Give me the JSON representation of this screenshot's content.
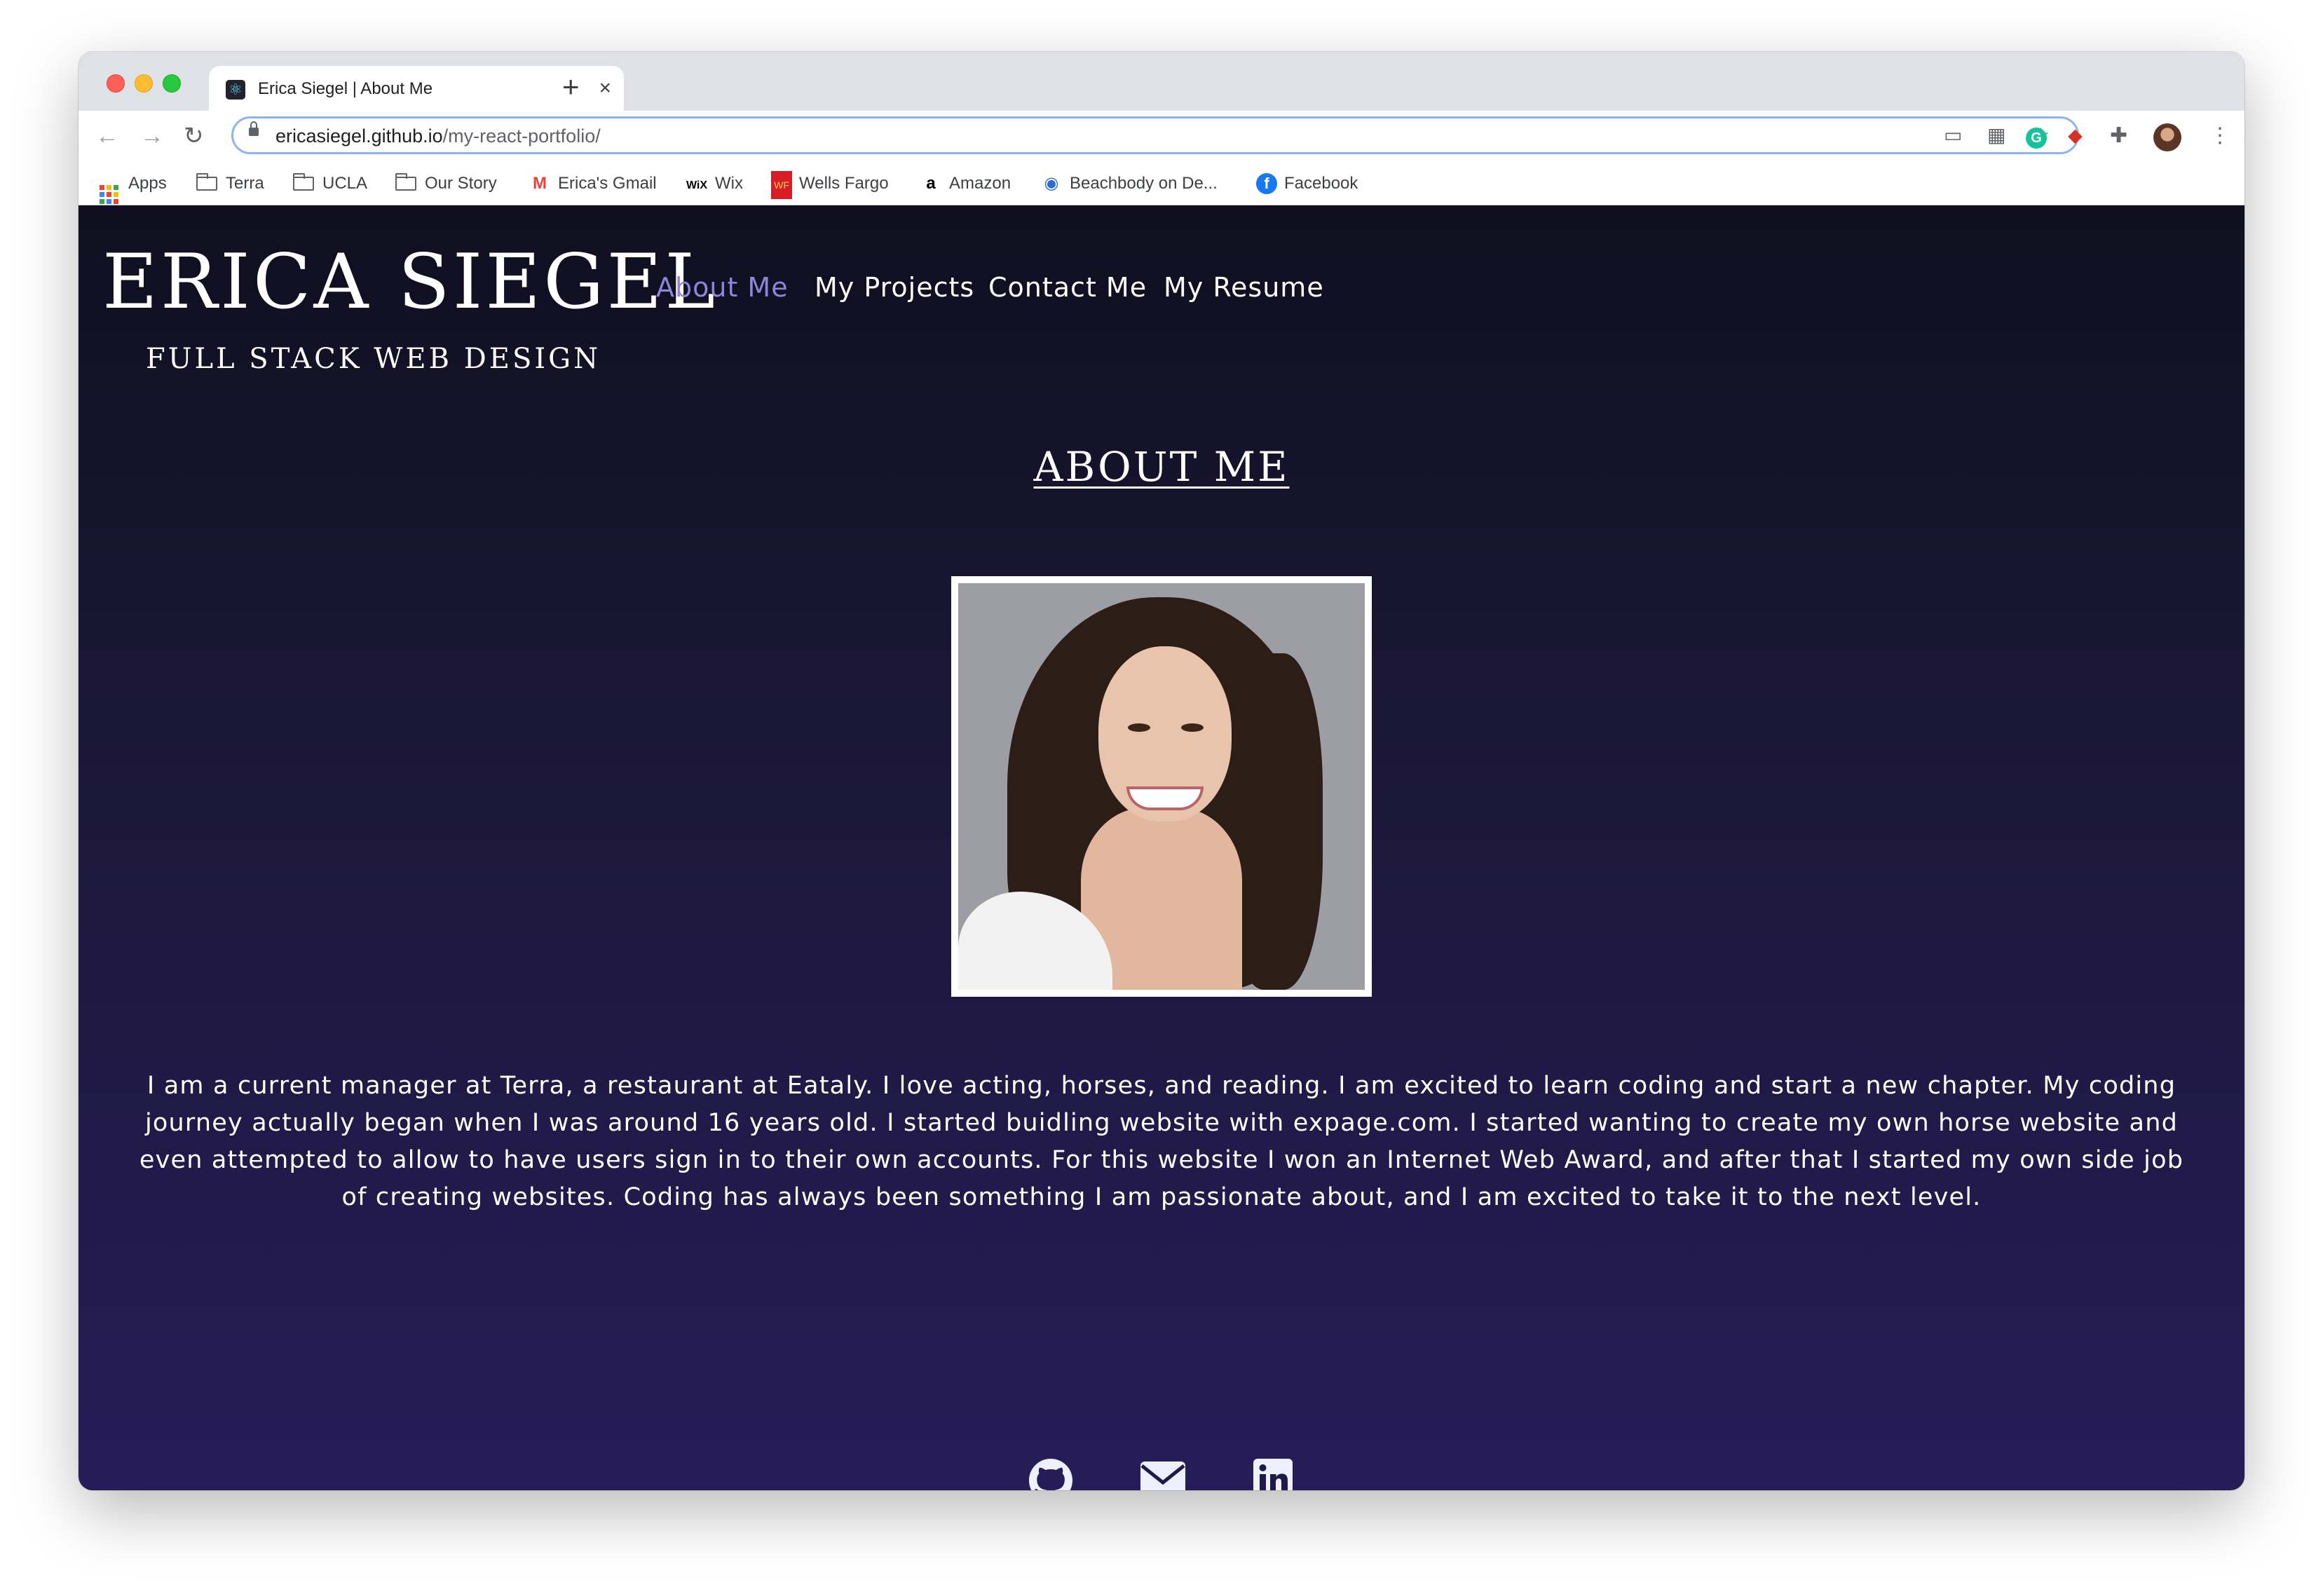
{
  "browser": {
    "tab_title": "Erica Siegel | About Me",
    "tab_close": "×",
    "new_tab": "+",
    "url_host": "ericasiegel.github.io",
    "url_path": "/my-react-portfolio/",
    "bookmarks": [
      {
        "label": "Apps",
        "icon": "apps-grid-icon"
      },
      {
        "label": "Terra",
        "icon": "folder-icon"
      },
      {
        "label": "UCLA",
        "icon": "folder-icon"
      },
      {
        "label": "Our Story",
        "icon": "folder-icon"
      },
      {
        "label": "Erica's Gmail",
        "icon": "gmail-icon"
      },
      {
        "label": "Wix",
        "icon": "wix-icon"
      },
      {
        "label": "Wells Fargo",
        "icon": "wells-fargo-icon"
      },
      {
        "label": "Amazon",
        "icon": "amazon-icon"
      },
      {
        "label": "Beachbody on De...",
        "icon": "beachbody-icon"
      },
      {
        "label": "Facebook",
        "icon": "facebook-icon"
      }
    ]
  },
  "site": {
    "brand_name": "ERICA SIEGEL",
    "brand_subtitle": "FULL STACK WEB DESIGN",
    "nav": [
      {
        "label": "About Me",
        "active": true
      },
      {
        "label": "My Projects",
        "active": false
      },
      {
        "label": "Contact Me",
        "active": false
      },
      {
        "label": "My Resume",
        "active": false
      }
    ],
    "section_title": "ABOUT ME",
    "bio": "I am a current manager at Terra, a restaurant at Eataly. I love acting, horses, and reading. I am excited to learn coding and start a new chapter. My coding journey actually began when I was around 16 years old. I started buidling website with expage.com. I started wanting to create my own horse website and even attempted to allow to have users sign in to their own accounts. For this website I won an Internet Web Award, and after that I started my own side job of creating websites. Coding has always been something I am passionate about, and I am excited to take it to the next level.",
    "social_icons": [
      "github-icon",
      "envelope-icon",
      "linkedin-icon"
    ]
  },
  "colors": {
    "active_nav": "#8f84d8",
    "page_top": "#0f0f1f",
    "page_bottom": "#261c58",
    "icon_color": "#eef0ff"
  }
}
